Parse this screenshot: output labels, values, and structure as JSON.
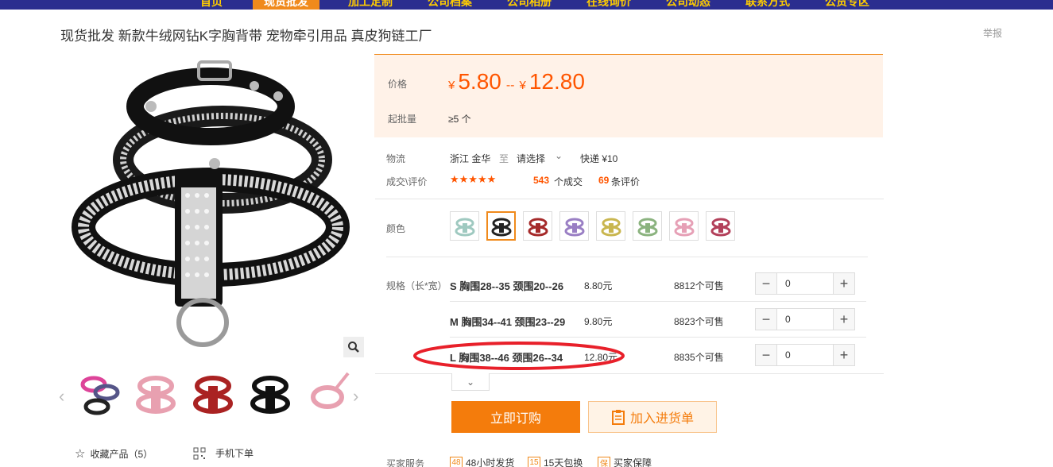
{
  "nav": {
    "items": [
      {
        "label": "首页"
      },
      {
        "label": "现货批发",
        "active": true
      },
      {
        "label": "加工定制"
      },
      {
        "label": "公司档案"
      },
      {
        "label": "公司相册"
      },
      {
        "label": "在线询价"
      },
      {
        "label": "公司动态"
      },
      {
        "label": "联系方式"
      },
      {
        "label": "公货专区"
      }
    ]
  },
  "product": {
    "title": "现货批发 新款牛绒网钻K字胸背带 宠物牵引用品 真皮狗链工厂",
    "report": "举报"
  },
  "price": {
    "label": "价格",
    "yen": "¥",
    "low": "5.80",
    "sep": "--",
    "high": "12.80",
    "moq_label": "起批量",
    "moq_value": "≥5 个"
  },
  "logistics": {
    "label": "物流",
    "origin": "浙江 金华",
    "to": "至",
    "select": "请选择",
    "express": "快递 ¥10"
  },
  "deals": {
    "label": "成交\\评价",
    "stars": "★★★★★",
    "count": "543",
    "count_suffix": "个成交",
    "reviews": "69",
    "reviews_suffix": "条评价"
  },
  "color": {
    "label": "颜色",
    "swatches": [
      "#9fc9c0",
      "#222222",
      "#a52a2a",
      "#9a7fc4",
      "#c9b64f",
      "#8bb37f",
      "#e6a0b6",
      "#b3405a"
    ]
  },
  "specs": {
    "label": "规格（长*宽）",
    "rows": [
      {
        "name": "S 胸围28--35 颈围20--26",
        "price": "8.80元",
        "avail": "8812个可售",
        "qty": "0"
      },
      {
        "name": "M 胸围34--41 颈围23--29",
        "price": "9.80元",
        "avail": "8823个可售",
        "qty": "0"
      },
      {
        "name": "L 胸围38--46 颈围26--34",
        "price": "12.80元",
        "avail": "8835个可售",
        "qty": "0"
      }
    ]
  },
  "actions": {
    "buy": "立即订购",
    "cart": "加入进货单"
  },
  "sidebar": {
    "collect": "收藏产品（5）",
    "mobile": "手机下单"
  },
  "services": {
    "label": "买家服务",
    "items": [
      {
        "icon": "48",
        "text": "48小时发货"
      },
      {
        "icon": "15",
        "text": "15天包换"
      },
      {
        "icon": "保",
        "text": "买家保障"
      }
    ]
  },
  "colors": {
    "accent": "#f08a1c",
    "price": "#ff5500",
    "nav_bg": "#2b2e8f",
    "annotation": "#e8202a"
  }
}
